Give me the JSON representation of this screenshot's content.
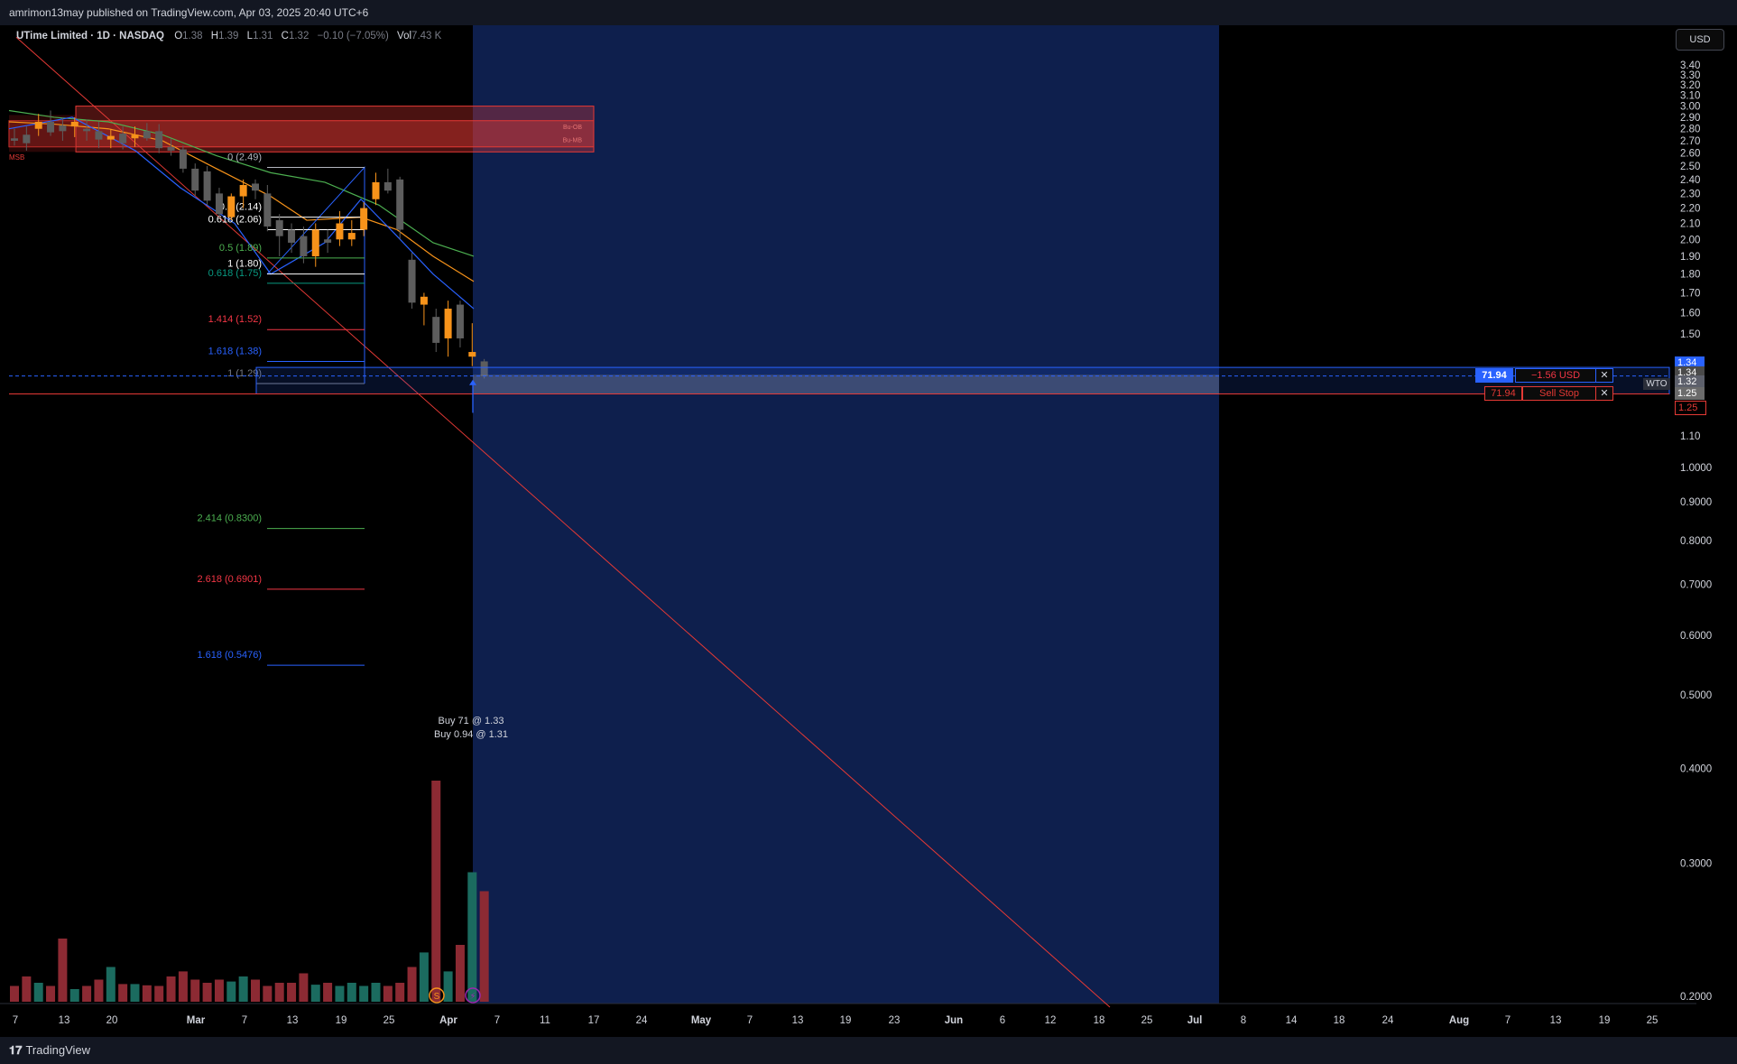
{
  "header": {
    "published_by": "amrimon13may published on TradingView.com, Apr 03, 2025 20:40 UTC+6"
  },
  "legend": {
    "symbol": "UTime Limited · 1D · NASDAQ",
    "o_label": "O",
    "o": "1.38",
    "h_label": "H",
    "h": "1.39",
    "l_label": "L",
    "l": "1.31",
    "c_label": "C",
    "c": "1.32",
    "change": "−0.10 (−7.05%)",
    "vol_label": "Vol",
    "vol": "7.43 K"
  },
  "currency": "USD",
  "footer": {
    "brand": "TradingView"
  },
  "colors": {
    "bull": "#f7931a",
    "bear": "#5d5d5d",
    "zone": "#e53935",
    "projection": "#0e1f4d",
    "vol_bull": "#1b6b5f",
    "vol_bear": "#8c2a33"
  },
  "chart_data": {
    "type": "candlestick",
    "symbol": "UTime Limited",
    "interval": "1D",
    "exchange": "NASDAQ",
    "price_axis": {
      "labels": [
        "3.40",
        "3.30",
        "3.20",
        "3.10",
        "3.00",
        "2.90",
        "2.80",
        "2.70",
        "2.60",
        "2.50",
        "2.40",
        "2.30",
        "2.20",
        "2.10",
        "2.00",
        "1.90",
        "1.80",
        "1.70",
        "1.60",
        "1.50",
        "1.10",
        "1.0000",
        "0.9000",
        "0.8000",
        "0.7000",
        "0.6000",
        "0.5000",
        "0.4000",
        "0.3000",
        "0.2000"
      ],
      "values": [
        3.4,
        3.3,
        3.2,
        3.1,
        3.0,
        2.9,
        2.8,
        2.7,
        2.6,
        2.5,
        2.4,
        2.3,
        2.2,
        2.1,
        2.0,
        1.9,
        1.8,
        1.7,
        1.6,
        1.5,
        1.1,
        1.0,
        0.9,
        0.8,
        0.7,
        0.6,
        0.5,
        0.4,
        0.3,
        0.2
      ],
      "scale": "log"
    },
    "time_axis": {
      "labels": [
        "7",
        "13",
        "20",
        "Mar",
        "7",
        "13",
        "19",
        "25",
        "Apr",
        "7",
        "11",
        "17",
        "24",
        "May",
        "7",
        "13",
        "19",
        "23",
        "Jun",
        "6",
        "12",
        "18",
        "25",
        "Jul",
        "8",
        "14",
        "18",
        "24",
        "Aug",
        "7",
        "13",
        "19",
        "25"
      ]
    },
    "candles": [
      {
        "o": 2.72,
        "h": 2.8,
        "l": 2.66,
        "c": 2.7
      },
      {
        "o": 2.75,
        "h": 2.82,
        "l": 2.62,
        "c": 2.68
      },
      {
        "o": 2.8,
        "h": 2.93,
        "l": 2.74,
        "c": 2.86
      },
      {
        "o": 2.86,
        "h": 2.96,
        "l": 2.74,
        "c": 2.77
      },
      {
        "o": 2.83,
        "h": 2.9,
        "l": 2.7,
        "c": 2.78
      },
      {
        "o": 2.82,
        "h": 2.9,
        "l": 2.73,
        "c": 2.86
      },
      {
        "o": 2.8,
        "h": 2.88,
        "l": 2.7,
        "c": 2.78
      },
      {
        "o": 2.78,
        "h": 2.86,
        "l": 2.64,
        "c": 2.71
      },
      {
        "o": 2.71,
        "h": 2.8,
        "l": 2.64,
        "c": 2.74
      },
      {
        "o": 2.76,
        "h": 2.82,
        "l": 2.63,
        "c": 2.68
      },
      {
        "o": 2.72,
        "h": 2.82,
        "l": 2.65,
        "c": 2.75
      },
      {
        "o": 2.78,
        "h": 2.85,
        "l": 2.7,
        "c": 2.72
      },
      {
        "o": 2.78,
        "h": 2.84,
        "l": 2.6,
        "c": 2.64
      },
      {
        "o": 2.65,
        "h": 2.72,
        "l": 2.58,
        "c": 2.62
      },
      {
        "o": 2.63,
        "h": 2.66,
        "l": 2.45,
        "c": 2.48
      },
      {
        "o": 2.48,
        "h": 2.52,
        "l": 2.28,
        "c": 2.32
      },
      {
        "o": 2.46,
        "h": 2.5,
        "l": 2.22,
        "c": 2.25
      },
      {
        "o": 2.3,
        "h": 2.34,
        "l": 2.14,
        "c": 2.16
      },
      {
        "o": 2.14,
        "h": 2.3,
        "l": 2.12,
        "c": 2.28
      },
      {
        "o": 2.28,
        "h": 2.4,
        "l": 2.2,
        "c": 2.36
      },
      {
        "o": 2.37,
        "h": 2.4,
        "l": 2.26,
        "c": 2.32
      },
      {
        "o": 2.3,
        "h": 2.36,
        "l": 2.05,
        "c": 2.08
      },
      {
        "o": 2.12,
        "h": 2.16,
        "l": 1.9,
        "c": 2.02
      },
      {
        "o": 2.06,
        "h": 2.1,
        "l": 1.92,
        "c": 1.98
      },
      {
        "o": 2.02,
        "h": 2.08,
        "l": 1.86,
        "c": 1.9
      },
      {
        "o": 1.9,
        "h": 2.1,
        "l": 1.84,
        "c": 2.06
      },
      {
        "o": 2.0,
        "h": 2.06,
        "l": 1.92,
        "c": 1.98
      },
      {
        "o": 2.0,
        "h": 2.18,
        "l": 1.96,
        "c": 2.1
      },
      {
        "o": 2.0,
        "h": 2.12,
        "l": 1.96,
        "c": 2.04
      },
      {
        "o": 2.06,
        "h": 2.24,
        "l": 2.02,
        "c": 2.2
      },
      {
        "o": 2.26,
        "h": 2.45,
        "l": 2.22,
        "c": 2.38
      },
      {
        "o": 2.38,
        "h": 2.48,
        "l": 2.3,
        "c": 2.32
      },
      {
        "o": 2.4,
        "h": 2.42,
        "l": 2.0,
        "c": 2.06
      },
      {
        "o": 1.88,
        "h": 1.92,
        "l": 1.62,
        "c": 1.65
      },
      {
        "o": 1.64,
        "h": 1.7,
        "l": 1.54,
        "c": 1.68
      },
      {
        "o": 1.58,
        "h": 1.62,
        "l": 1.42,
        "c": 1.46
      },
      {
        "o": 1.48,
        "h": 1.66,
        "l": 1.4,
        "c": 1.62
      },
      {
        "o": 1.64,
        "h": 1.66,
        "l": 1.44,
        "c": 1.48
      },
      {
        "o": 1.4,
        "h": 1.55,
        "l": 1.36,
        "c": 1.42
      },
      {
        "o": 1.38,
        "h": 1.39,
        "l": 1.31,
        "c": 1.32
      }
    ],
    "volume": [
      0.25,
      0.4,
      0.3,
      0.25,
      1.0,
      0.2,
      0.25,
      0.35,
      0.55,
      0.28,
      0.28,
      0.26,
      0.25,
      0.4,
      0.48,
      0.35,
      0.3,
      0.35,
      0.32,
      0.4,
      0.35,
      0.25,
      0.3,
      0.3,
      0.45,
      0.27,
      0.3,
      0.25,
      0.3,
      0.25,
      0.3,
      0.25,
      0.3,
      0.55,
      0.78,
      3.5,
      0.48,
      0.9,
      2.05,
      1.75
    ],
    "zones": [
      {
        "top": 3.0,
        "bottom": 2.61,
        "label": "Bu-OB"
      },
      {
        "top": 2.87,
        "bottom": 2.65,
        "label": "Bu-MB"
      }
    ],
    "zone_tag": "MSB",
    "fib_levels": [
      {
        "label": "0 (2.49)",
        "value": 2.49,
        "color": "#b2b5be"
      },
      {
        "label": "0.5 (2.14)",
        "value": 2.14,
        "color": "#ffffff"
      },
      {
        "label": "0.618 (2.06)",
        "value": 2.06,
        "color": "#ffffff"
      },
      {
        "label": "0.5 (1.89)",
        "value": 1.89,
        "color": "#4caf50"
      },
      {
        "label": "1 (1.80)",
        "value": 1.8,
        "color": "#ffffff"
      },
      {
        "label": "0.618 (1.75)",
        "value": 1.75,
        "color": "#089981"
      },
      {
        "label": "1.414 (1.52)",
        "value": 1.52,
        "color": "#f23645"
      },
      {
        "label": "1.618 (1.38)",
        "value": 1.38,
        "color": "#2962ff"
      },
      {
        "label": "1 (1.29)",
        "value": 1.29,
        "color": "#787b86"
      },
      {
        "label": "2.414 (0.8300)",
        "value": 0.83,
        "color": "#4caf50"
      },
      {
        "label": "2.618 (0.6901)",
        "value": 0.6901,
        "color": "#f23645"
      },
      {
        "label": "1.618 (0.5476)",
        "value": 0.5476,
        "color": "#2962ff"
      }
    ],
    "executions": [
      "Buy 71 @ 1.33",
      "Buy 0.94 @ 1.31"
    ],
    "positions": {
      "long": {
        "qty": "71.94",
        "pnl": "−1.56 USD",
        "close": "✕"
      },
      "sell_stop": {
        "qty": "71.94",
        "label": "Sell Stop",
        "close": "✕"
      }
    },
    "price_badges": [
      {
        "text": "1.34",
        "bg": "#2962ff",
        "value": 1.345
      },
      {
        "text": "1.34",
        "bg": "#4a4a4a",
        "value": 1.34
      },
      {
        "text": "1.32",
        "bg": "#5d606b",
        "value": 1.32
      },
      {
        "text": "1.25",
        "bg": "#6b6b6b",
        "value": 1.25
      },
      {
        "text": "1.25",
        "bg": "#000000",
        "value": 1.24
      }
    ],
    "wto": "WTO",
    "event_icons": [
      "S",
      "⚡"
    ]
  }
}
